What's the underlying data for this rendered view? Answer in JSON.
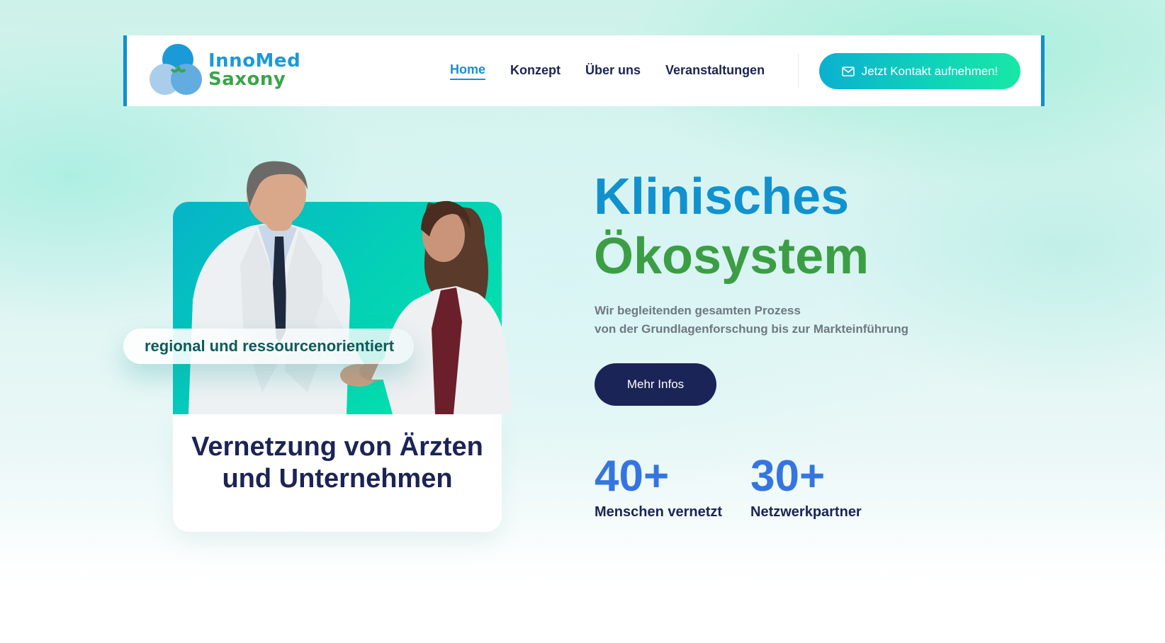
{
  "header": {
    "logo": {
      "line1": "InnoMed",
      "line2": "Saxony"
    },
    "nav": [
      {
        "label": "Home",
        "active": true
      },
      {
        "label": "Konzept",
        "active": false
      },
      {
        "label": "Über uns",
        "active": false
      },
      {
        "label": "Veranstaltungen",
        "active": false
      }
    ],
    "cta": {
      "label": "Jetzt Kontakt aufnehmen!",
      "icon": "mail-icon"
    }
  },
  "feature_card": {
    "badge": "regional und ressourcenorientiert",
    "title_line1": "Vernetzung von Ärzten",
    "title_line2": "und Unternehmen"
  },
  "hero": {
    "title_line1": "Klinisches",
    "title_line2": "Ökosystem",
    "subtitle_line1": "Wir begleitenden gesamten Prozess",
    "subtitle_line2": "von der Grundlagenforschung bis zur Markteinführung",
    "button": "Mehr Infos"
  },
  "stats": [
    {
      "value": "40+",
      "label": "Menschen vernetzt"
    },
    {
      "value": "30+",
      "label": "Netzwerkpartner"
    }
  ],
  "colors": {
    "brand_blue": "#1192cf",
    "brand_green": "#3c9e44",
    "navy": "#1b2454",
    "stat_blue": "#3575df",
    "cta_gradient_start": "#0bb0d0",
    "cta_gradient_end": "#18e8a6"
  }
}
